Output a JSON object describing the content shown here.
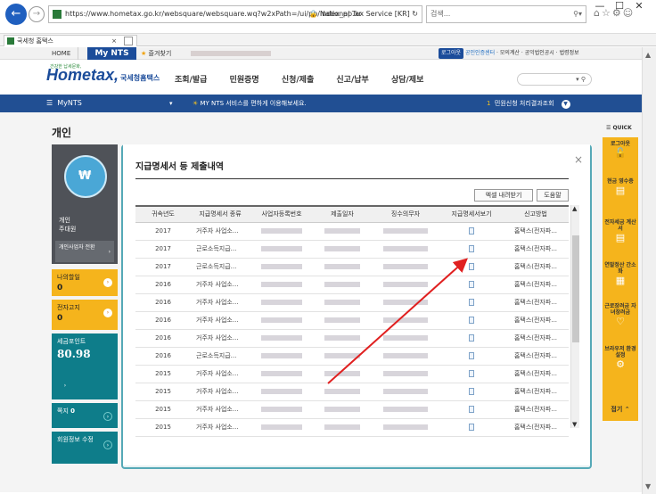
{
  "browser": {
    "url": "https://www.hometax.go.kr/websquare/websquare.wq?w2xPath=/ui/pp/index_pp.xr",
    "site_identity": "National Tax Service [KR]",
    "search_placeholder": "검색...",
    "tab_title": "국세청 홈택스",
    "tab_close": "×"
  },
  "topbar": {
    "home": "HOME",
    "mynts": "My NTS",
    "favorites": "즐겨찾기",
    "logout": "로그아웃",
    "cert_center": "공인인증센터",
    "mock_calc": "모의계산",
    "notice_law": "공익법인공시",
    "legal_info": "법령정보"
  },
  "logo": {
    "tagline": "건강한 납세문화,",
    "brand": "Hometax,",
    "sub": "국세청홈택스"
  },
  "mainnav": [
    "조회/발급",
    "민원증명",
    "신청/제출",
    "신고/납부",
    "상담/제보"
  ],
  "bluebar": {
    "menu": "MyNTS",
    "notice": "MY NTS 서비스를 편하게 이용해보세요.",
    "right_num": "1",
    "right_text": "민원신청 처리결과조회"
  },
  "page": {
    "title": "개인"
  },
  "left_panel": {
    "profile_label": "개인",
    "profile_sub": "주대원",
    "biz_switch": "개인사업자 전환",
    "mail_label": "나의할일",
    "mail_value": "0",
    "elec_label": "전자고지",
    "elec_value": "0",
    "points_label": "세금포인트",
    "points_value": "80.98",
    "notes_label": "쪽지",
    "notes_value": "0",
    "member_label": "회원정보 수정"
  },
  "quick": {
    "label": "QUICK",
    "items": [
      "로그아웃",
      "현금 영수증",
      "전자세금 계산서",
      "연말정산 간소화",
      "근로장려금 자녀장려금",
      "브라우저 환경설정"
    ],
    "close": "접기"
  },
  "modal": {
    "title": "지급명세서 등 제출내역",
    "close": "×",
    "excel": "엑셀 내려받기",
    "help": "도움말",
    "columns": [
      "귀속년도",
      "지급명세서 종류",
      "사업자등록번호",
      "제출일자",
      "징수의무자",
      "지급명세서보기",
      "신고방법"
    ],
    "rows": [
      {
        "year": "2017",
        "kind": "거주자 사업소...",
        "method": "홈택스(전자파..."
      },
      {
        "year": "2017",
        "kind": "근로소득지급...",
        "method": "홈택스(전자파..."
      },
      {
        "year": "2017",
        "kind": "근로소득지급...",
        "method": "홈택스(전자파..."
      },
      {
        "year": "2016",
        "kind": "거주자 사업소...",
        "method": "홈택스(전자파..."
      },
      {
        "year": "2016",
        "kind": "거주자 사업소...",
        "method": "홈택스(전자파..."
      },
      {
        "year": "2016",
        "kind": "거주자 사업소...",
        "method": "홈택스(전자파..."
      },
      {
        "year": "2016",
        "kind": "거주자 사업소...",
        "method": "홈택스(전자파..."
      },
      {
        "year": "2016",
        "kind": "근로소득지급...",
        "method": "홈택스(전자파..."
      },
      {
        "year": "2015",
        "kind": "거주자 사업소...",
        "method": "홈택스(전자파..."
      },
      {
        "year": "2015",
        "kind": "거주자 사업소...",
        "method": "홈택스(전자파..."
      },
      {
        "year": "2015",
        "kind": "거주자 사업소...",
        "method": "홈택스(전자파..."
      },
      {
        "year": "2015",
        "kind": "거주자 사업소...",
        "method": "홈택스(전자파..."
      }
    ]
  },
  "colors": {
    "brand_blue": "#1b4c9a",
    "nav_bar": "#214f93",
    "accent_yellow": "#f5b41c",
    "teal": "#0e7d8a",
    "annotation_arrow": "#e02020"
  }
}
